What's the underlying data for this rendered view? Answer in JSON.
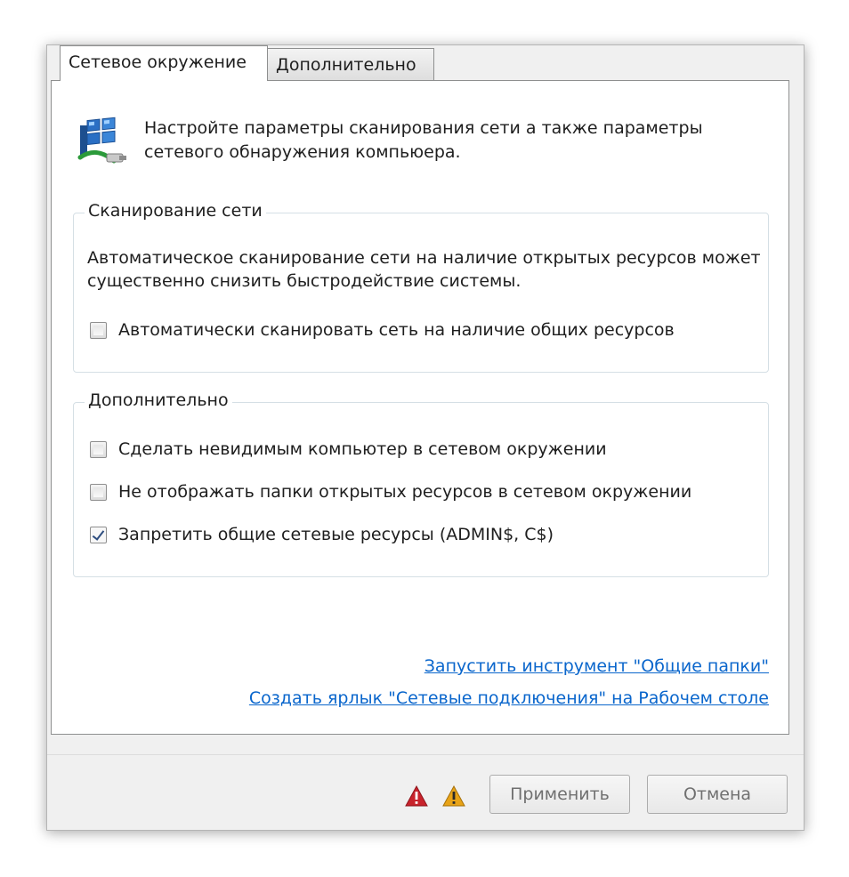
{
  "tabs": [
    {
      "label": "Сетевое окружение",
      "active": true
    },
    {
      "label": "Дополнительно",
      "active": false
    }
  ],
  "intro": {
    "icon": "network-icon",
    "text": "Настройте параметры сканирования сети а также параметры сетевого обнаружения компьюера."
  },
  "scan_group": {
    "title": "Сканирование сети",
    "description": "Автоматическое сканирование сети на наличие открытых ресурсов может существенно снизить быстродействие системы.",
    "options": [
      {
        "label": "Автоматически сканировать сеть на наличие общих ресурсов",
        "checked": false
      }
    ]
  },
  "extra_group": {
    "title": "Дополнительно",
    "options": [
      {
        "label": "Сделать невидимым компьютер в сетевом окружении",
        "checked": false
      },
      {
        "label": "Не отображать папки открытых ресурсов в сетевом окружении",
        "checked": false
      },
      {
        "label": "Запретить общие сетевые ресурсы (ADMIN$, C$)",
        "checked": true
      }
    ]
  },
  "links": [
    "Запустить инструмент \"Общие папки\"",
    "Создать ярлык \"Сетевые подключения\" на Рабочем столе"
  ],
  "footer": {
    "icons": [
      "error-icon",
      "warning-icon"
    ],
    "colors": {
      "error": "#c8232c",
      "warning": "#e8a317"
    },
    "apply_label": "Применить",
    "cancel_label": "Отмена"
  }
}
